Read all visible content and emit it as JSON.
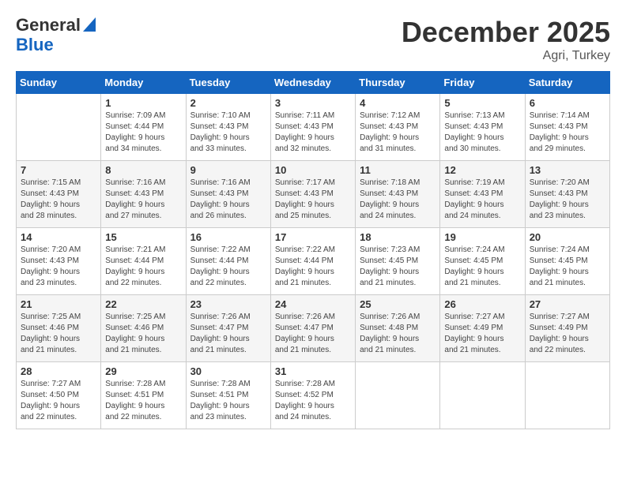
{
  "header": {
    "logo_line1": "General",
    "logo_line2": "Blue",
    "month_title": "December 2025",
    "location": "Agri, Turkey"
  },
  "days_of_week": [
    "Sunday",
    "Monday",
    "Tuesday",
    "Wednesday",
    "Thursday",
    "Friday",
    "Saturday"
  ],
  "weeks": [
    [
      {
        "day": "",
        "info": ""
      },
      {
        "day": "1",
        "info": "Sunrise: 7:09 AM\nSunset: 4:44 PM\nDaylight: 9 hours\nand 34 minutes."
      },
      {
        "day": "2",
        "info": "Sunrise: 7:10 AM\nSunset: 4:43 PM\nDaylight: 9 hours\nand 33 minutes."
      },
      {
        "day": "3",
        "info": "Sunrise: 7:11 AM\nSunset: 4:43 PM\nDaylight: 9 hours\nand 32 minutes."
      },
      {
        "day": "4",
        "info": "Sunrise: 7:12 AM\nSunset: 4:43 PM\nDaylight: 9 hours\nand 31 minutes."
      },
      {
        "day": "5",
        "info": "Sunrise: 7:13 AM\nSunset: 4:43 PM\nDaylight: 9 hours\nand 30 minutes."
      },
      {
        "day": "6",
        "info": "Sunrise: 7:14 AM\nSunset: 4:43 PM\nDaylight: 9 hours\nand 29 minutes."
      }
    ],
    [
      {
        "day": "7",
        "info": "Sunrise: 7:15 AM\nSunset: 4:43 PM\nDaylight: 9 hours\nand 28 minutes."
      },
      {
        "day": "8",
        "info": "Sunrise: 7:16 AM\nSunset: 4:43 PM\nDaylight: 9 hours\nand 27 minutes."
      },
      {
        "day": "9",
        "info": "Sunrise: 7:16 AM\nSunset: 4:43 PM\nDaylight: 9 hours\nand 26 minutes."
      },
      {
        "day": "10",
        "info": "Sunrise: 7:17 AM\nSunset: 4:43 PM\nDaylight: 9 hours\nand 25 minutes."
      },
      {
        "day": "11",
        "info": "Sunrise: 7:18 AM\nSunset: 4:43 PM\nDaylight: 9 hours\nand 24 minutes."
      },
      {
        "day": "12",
        "info": "Sunrise: 7:19 AM\nSunset: 4:43 PM\nDaylight: 9 hours\nand 24 minutes."
      },
      {
        "day": "13",
        "info": "Sunrise: 7:20 AM\nSunset: 4:43 PM\nDaylight: 9 hours\nand 23 minutes."
      }
    ],
    [
      {
        "day": "14",
        "info": "Sunrise: 7:20 AM\nSunset: 4:43 PM\nDaylight: 9 hours\nand 23 minutes."
      },
      {
        "day": "15",
        "info": "Sunrise: 7:21 AM\nSunset: 4:44 PM\nDaylight: 9 hours\nand 22 minutes."
      },
      {
        "day": "16",
        "info": "Sunrise: 7:22 AM\nSunset: 4:44 PM\nDaylight: 9 hours\nand 22 minutes."
      },
      {
        "day": "17",
        "info": "Sunrise: 7:22 AM\nSunset: 4:44 PM\nDaylight: 9 hours\nand 21 minutes."
      },
      {
        "day": "18",
        "info": "Sunrise: 7:23 AM\nSunset: 4:45 PM\nDaylight: 9 hours\nand 21 minutes."
      },
      {
        "day": "19",
        "info": "Sunrise: 7:24 AM\nSunset: 4:45 PM\nDaylight: 9 hours\nand 21 minutes."
      },
      {
        "day": "20",
        "info": "Sunrise: 7:24 AM\nSunset: 4:45 PM\nDaylight: 9 hours\nand 21 minutes."
      }
    ],
    [
      {
        "day": "21",
        "info": "Sunrise: 7:25 AM\nSunset: 4:46 PM\nDaylight: 9 hours\nand 21 minutes."
      },
      {
        "day": "22",
        "info": "Sunrise: 7:25 AM\nSunset: 4:46 PM\nDaylight: 9 hours\nand 21 minutes."
      },
      {
        "day": "23",
        "info": "Sunrise: 7:26 AM\nSunset: 4:47 PM\nDaylight: 9 hours\nand 21 minutes."
      },
      {
        "day": "24",
        "info": "Sunrise: 7:26 AM\nSunset: 4:47 PM\nDaylight: 9 hours\nand 21 minutes."
      },
      {
        "day": "25",
        "info": "Sunrise: 7:26 AM\nSunset: 4:48 PM\nDaylight: 9 hours\nand 21 minutes."
      },
      {
        "day": "26",
        "info": "Sunrise: 7:27 AM\nSunset: 4:49 PM\nDaylight: 9 hours\nand 21 minutes."
      },
      {
        "day": "27",
        "info": "Sunrise: 7:27 AM\nSunset: 4:49 PM\nDaylight: 9 hours\nand 22 minutes."
      }
    ],
    [
      {
        "day": "28",
        "info": "Sunrise: 7:27 AM\nSunset: 4:50 PM\nDaylight: 9 hours\nand 22 minutes."
      },
      {
        "day": "29",
        "info": "Sunrise: 7:28 AM\nSunset: 4:51 PM\nDaylight: 9 hours\nand 22 minutes."
      },
      {
        "day": "30",
        "info": "Sunrise: 7:28 AM\nSunset: 4:51 PM\nDaylight: 9 hours\nand 23 minutes."
      },
      {
        "day": "31",
        "info": "Sunrise: 7:28 AM\nSunset: 4:52 PM\nDaylight: 9 hours\nand 24 minutes."
      },
      {
        "day": "",
        "info": ""
      },
      {
        "day": "",
        "info": ""
      },
      {
        "day": "",
        "info": ""
      }
    ]
  ]
}
